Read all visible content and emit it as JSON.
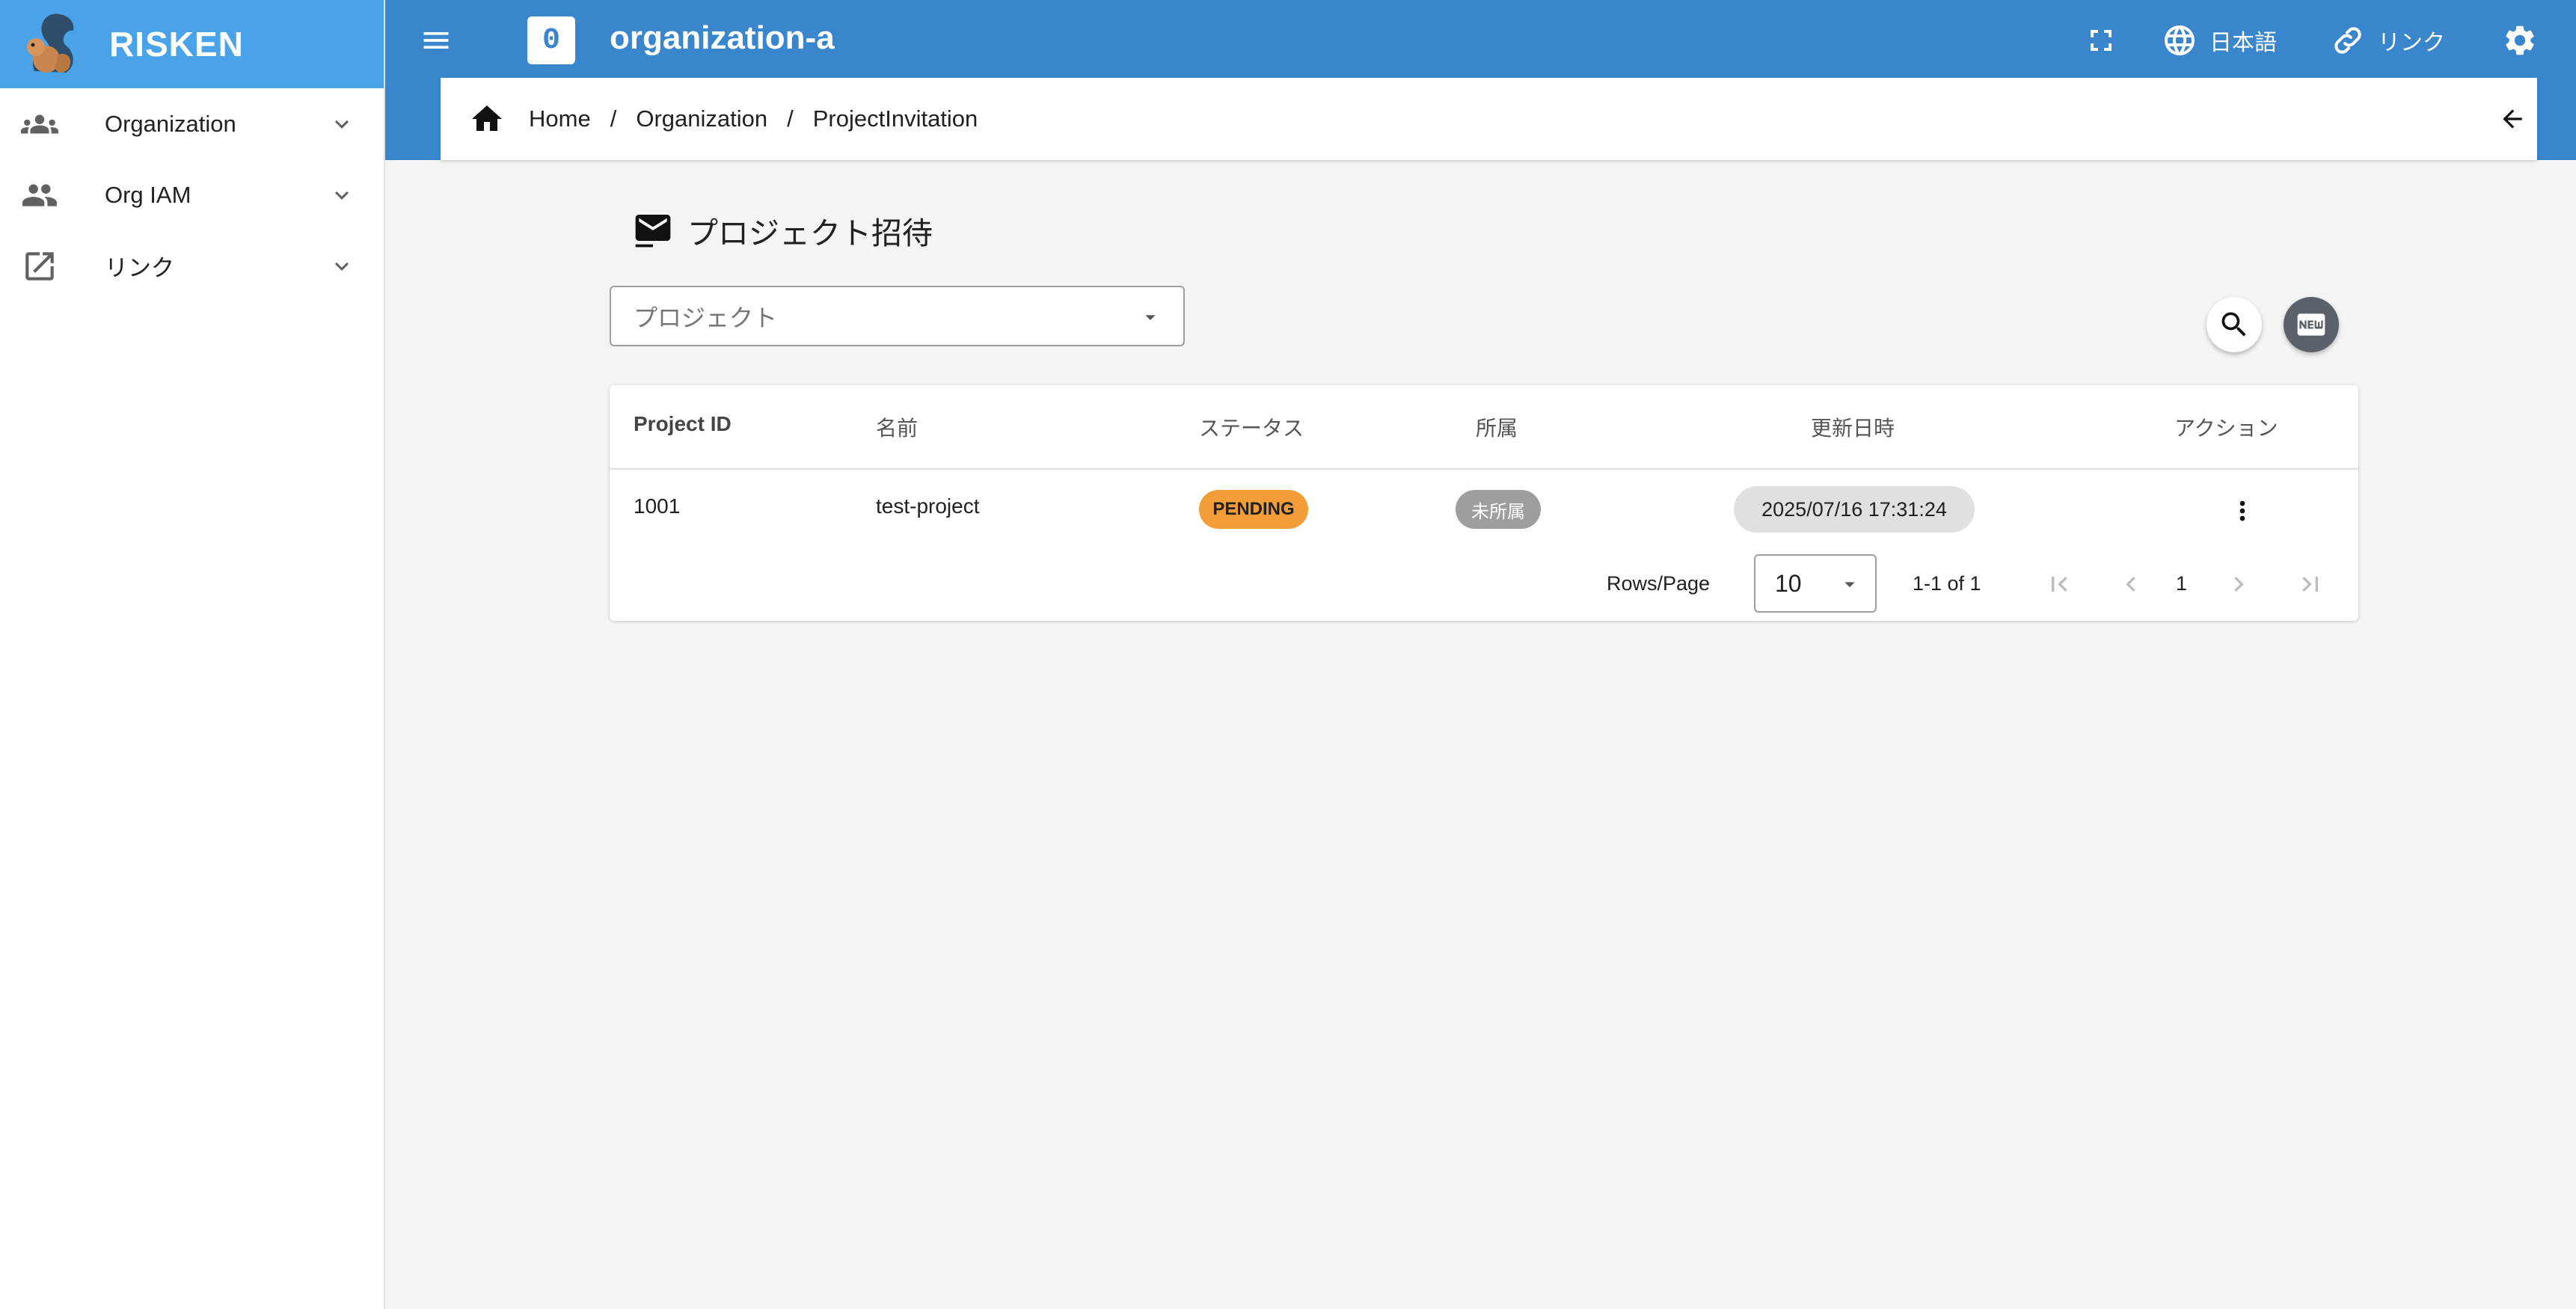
{
  "brand": {
    "name": "RISKEN",
    "logo_icon": "squirrel-logo"
  },
  "colors": {
    "appbar": "#3a86cc",
    "brand_bar": "#4aa3e8",
    "pending": "#f29d38",
    "unassigned": "#9e9e9e"
  },
  "sidebar": {
    "items": [
      {
        "label": "Organization",
        "icon": "groups-icon"
      },
      {
        "label": "Org IAM",
        "icon": "people-icon"
      },
      {
        "label": "リンク",
        "icon": "open-in-new-icon"
      }
    ]
  },
  "appbar": {
    "org_badge": "0",
    "org_name": "organization-a",
    "language_label": "日本語",
    "link_label": "リンク"
  },
  "breadcrumb": {
    "home": "Home",
    "organization": "Organization",
    "current": "ProjectInvitation",
    "separator": "/"
  },
  "page": {
    "title": "プロジェクト招待",
    "project_placeholder": "プロジェクト"
  },
  "table": {
    "headers": [
      "Project ID",
      "名前",
      "ステータス",
      "所属",
      "更新日時",
      "アクション"
    ],
    "rows": [
      {
        "project_id": "1001",
        "name": "test-project",
        "status": "PENDING",
        "affiliation": "未所属",
        "updated_at": "2025/07/16 17:31:24"
      }
    ],
    "footer": {
      "rows_per_page_label": "Rows/Page",
      "rows_per_page": "10",
      "range": "1-1 of 1",
      "page": "1"
    }
  }
}
